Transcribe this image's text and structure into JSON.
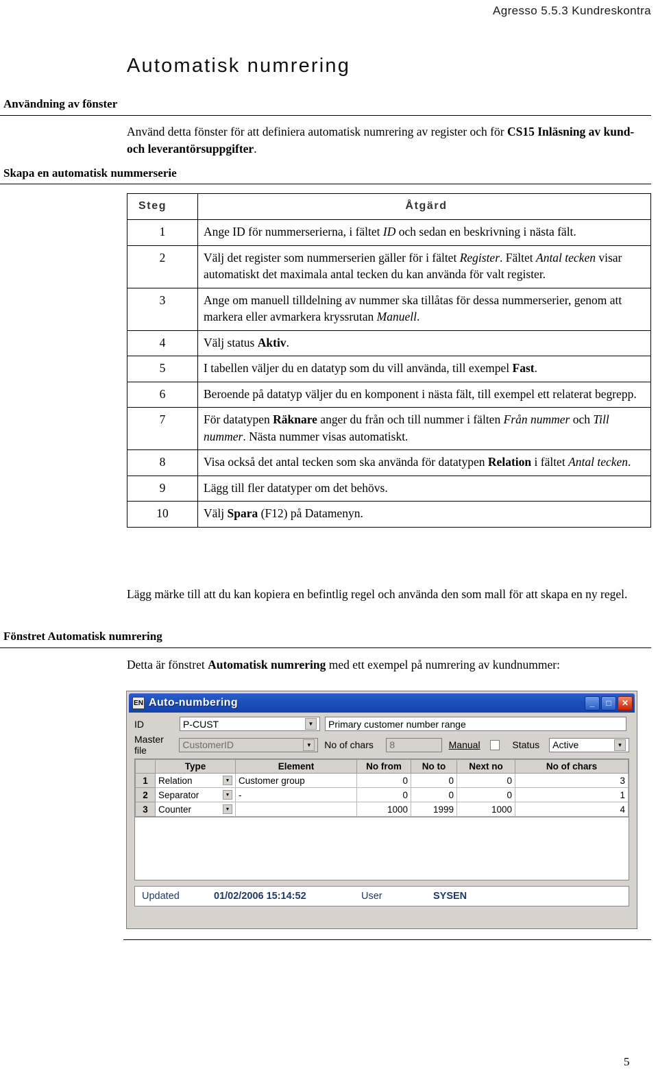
{
  "header": {
    "product": "Agresso 5.5.3 Kundreskontra"
  },
  "title": "Automatisk numrering",
  "margin_headings": {
    "usage": "Användning av fönster",
    "create_series": "Skapa en automatisk nummerserie",
    "window": "Fönstret Automatisk numrering"
  },
  "intro_paragraph": {
    "part1": "Använd detta fönster för att definiera automatisk numrering av register och för ",
    "bold1": "CS15 Inläsning av kund- och leverantörsuppgifter",
    "part2": "."
  },
  "steps_table": {
    "headers": {
      "step": "Steg",
      "action": "Åtgärd"
    },
    "rows": [
      {
        "step": "1",
        "action_html": "Ange ID för nummerserierna, i fältet <i>ID</i> och sedan en beskrivning i nästa fält."
      },
      {
        "step": "2",
        "action_html": "Välj det register som nummerserien gäller för i fältet <i>Register</i>. Fältet <i>Antal tecken</i> visar automatiskt det maximala antal tecken du kan använda för valt register."
      },
      {
        "step": "3",
        "action_html": "Ange om manuell tilldelning av nummer ska tillåtas för dessa nummerserier, genom att markera eller avmarkera kryssrutan <i>Manuell</i>."
      },
      {
        "step": "4",
        "action_html": "Välj status <b>Aktiv</b>."
      },
      {
        "step": "5",
        "action_html": "I tabellen väljer du en datatyp som du vill använda, till exempel <b>Fast</b>."
      },
      {
        "step": "6",
        "action_html": "Beroende på datatyp väljer du en komponent i nästa fält, till exempel ett relaterat begrepp."
      },
      {
        "step": "7",
        "action_html": "För datatypen <b>Räknare</b> anger du från och till nummer i fälten <i>Från nummer</i> och <i>Till nummer</i>. Nästa nummer visas automatiskt."
      },
      {
        "step": "8",
        "action_html": "Visa också det antal tecken som ska använda för datatypen <b>Relation</b> i fältet <i>Antal tecken</i>."
      },
      {
        "step": "9",
        "action_html": "Lägg till fler datatyper om det behövs."
      },
      {
        "step": "10",
        "action_html": "Välj <b>Spara</b> (F12) på Datamenyn."
      }
    ]
  },
  "note_paragraph": "Lägg märke till att du kan kopiera en befintlig regel och använda den som mall för att skapa en ny regel.",
  "window_paragraph": {
    "part1": "Detta är fönstret ",
    "bold1": "Automatisk numrering",
    "part2": " med ett exempel på numrering av kundnummer:"
  },
  "screenshot": {
    "titlebar": {
      "icon_text": "EN",
      "title": "Auto-numbering",
      "minimize": "_",
      "maximize": "□",
      "close": "✕"
    },
    "fields": {
      "id_label": "ID",
      "id_value": "P-CUST",
      "description_value": "Primary customer number range",
      "master_file_label": "Master file",
      "master_file_value": "CustomerID",
      "no_of_chars_label": "No of chars",
      "no_of_chars_value": "8",
      "manual_label": "Manual",
      "status_label": "Status",
      "status_value": "Active"
    },
    "grid": {
      "headers": [
        "Type",
        "Element",
        "No from",
        "No to",
        "Next no",
        "No of chars"
      ],
      "rows": [
        {
          "num": "1",
          "type": "Relation",
          "element": "Customer group",
          "no_from": "0",
          "no_to": "0",
          "next_no": "0",
          "no_of_chars": "3"
        },
        {
          "num": "2",
          "type": "Separator",
          "element": "-",
          "no_from": "0",
          "no_to": "0",
          "next_no": "0",
          "no_of_chars": "1"
        },
        {
          "num": "3",
          "type": "Counter",
          "element": "",
          "no_from": "1000",
          "no_to": "1999",
          "next_no": "1000",
          "no_of_chars": "4"
        }
      ]
    },
    "status_bar": {
      "updated_label": "Updated",
      "updated_value": "01/02/2006 15:14:52",
      "user_label": "User",
      "user_value": "SYSEN"
    }
  },
  "page_number": "5"
}
